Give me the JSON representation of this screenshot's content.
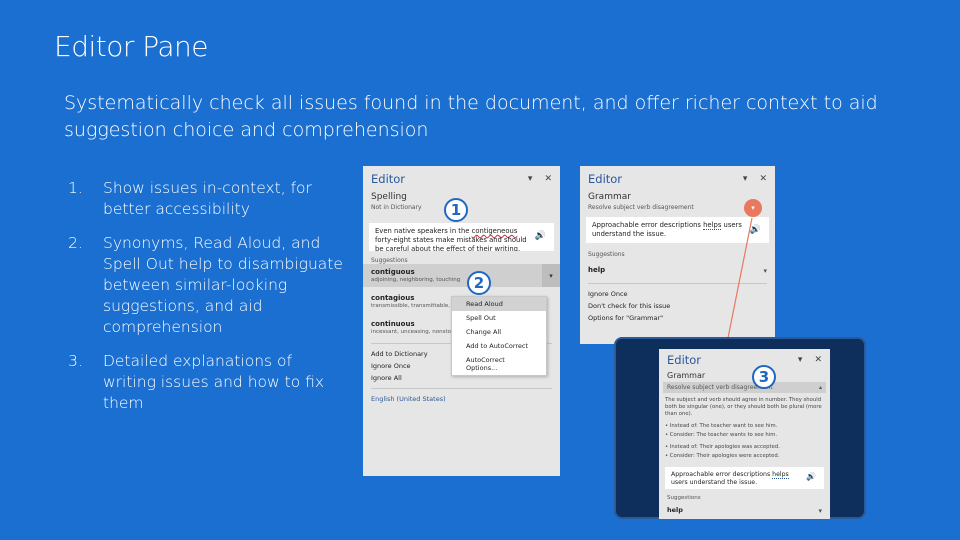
{
  "title": "Editor Pane",
  "subtitle": "Systematically check all issues found in the document, and offer richer context to aid suggestion choice and comprehension",
  "list": [
    {
      "num": "1.",
      "text": "Show issues in-context, for better accessibility"
    },
    {
      "num": "2.",
      "text": "Synonyms, Read Aloud, and Spell Out help to disambiguate between similar-looking suggestions, and aid comprehension"
    },
    {
      "num": "3.",
      "text": "Detailed explanations of writing issues and how to fix them"
    }
  ],
  "spelling_pane": {
    "title": "Editor",
    "section": "Spelling",
    "subsection": "Not in Dictionary",
    "context_before": "Even native speakers in the ",
    "context_error": "contigeneous",
    "context_after": " forty-eight states make mistakes and should be careful about the effect of their writing.",
    "suggestions_label": "Suggestions",
    "suggestions": [
      {
        "word": "contiguous",
        "synonyms": "adjoining, neighboring, touching"
      },
      {
        "word": "contagious",
        "synonyms": "transmissible, transmittable, i"
      },
      {
        "word": "continuous",
        "synonyms": "incessant, unceasing, nonstop"
      }
    ],
    "actions": [
      "Add to Dictionary",
      "Ignore Once",
      "Ignore All"
    ],
    "language": "English (United States)"
  },
  "context_menu": [
    "Read Aloud",
    "Spell Out",
    "Change All",
    "Add to AutoCorrect",
    "AutoCorrect Options..."
  ],
  "grammar_pane": {
    "title": "Editor",
    "section": "Grammar",
    "subsection": "Resolve subject verb disagreement",
    "context_before": "Approachable error descriptions ",
    "context_error": "helps",
    "context_after": " users understand the issue.",
    "suggestions_label": "Suggestions",
    "suggestion": "help",
    "actions": [
      "Ignore Once",
      "Don't check for this issue",
      "Options for \"Grammar\""
    ]
  },
  "zoom_pane": {
    "title": "Editor",
    "section": "Grammar",
    "subsection": "Resolve subject verb disagreement",
    "explanation": "The subject and verb should agree in number. They should both be singular (one), or they should both be plural (more than one).",
    "ex1": "• Instead of: The teacher want to see him.",
    "ex2": "• Consider: The teacher wants to see him.",
    "ex3": "• Instead of: Their apologies was accepted.",
    "ex4": "• Consider: Their apologies were accepted.",
    "context_before": "Approachable error descriptions ",
    "context_error": "helps",
    "context_after": " users understand the issue.",
    "suggestions_label": "Suggestions",
    "suggestion": "help"
  },
  "badges": [
    "1",
    "2",
    "3"
  ],
  "colors": {
    "background": "#1a6fd0",
    "pane": "#e6e6e6",
    "accent": "#2b579a",
    "orange": "#e8795f"
  }
}
